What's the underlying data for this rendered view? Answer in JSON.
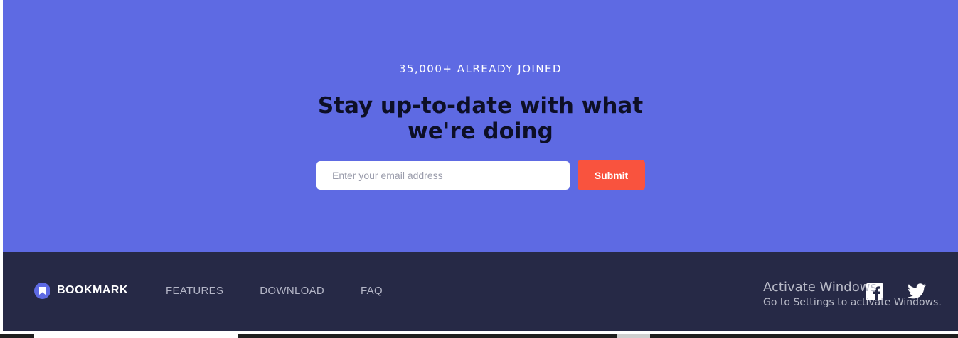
{
  "cta": {
    "kicker": "35,000+ ALREADY JOINED",
    "title": "Stay up-to-date with what we're doing",
    "email_placeholder": "Enter your email address",
    "submit_label": "Submit"
  },
  "footer": {
    "brand": "BOOKMARK",
    "nav": [
      "FEATURES",
      "DOWNLOAD",
      "FAQ"
    ],
    "social": [
      "facebook-icon",
      "twitter-icon"
    ]
  },
  "watermark": {
    "title": "Activate Windows",
    "subtitle": "Go to Settings to activate Windows."
  },
  "colors": {
    "primary": "#5e6ae3",
    "accent": "#f9533e",
    "footer_bg": "#262946",
    "title_text": "#0d0f26"
  }
}
